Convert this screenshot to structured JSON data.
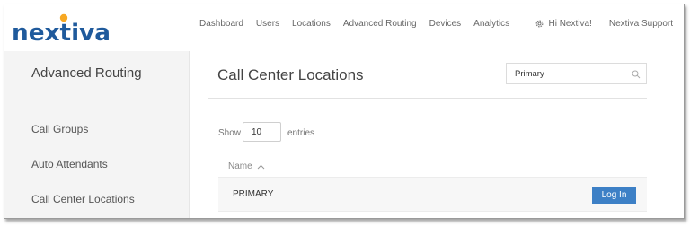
{
  "brand": {
    "logo_text": "nextiva",
    "logo_color": "#1f5a9c",
    "dot_color": "#f7a823"
  },
  "nav": {
    "items": [
      "Dashboard",
      "Users",
      "Locations",
      "Advanced Routing",
      "Devices",
      "Analytics"
    ],
    "greeting": "Hi Nextiva!",
    "support": "Nextiva Support",
    "gear_icon": "gear-icon"
  },
  "sidebar": {
    "title": "Advanced Routing",
    "items": [
      {
        "label": "Call Groups"
      },
      {
        "label": "Auto Attendants"
      },
      {
        "label": "Call Center Locations"
      }
    ]
  },
  "main": {
    "title": "Call Center Locations",
    "search": {
      "value": "Primary",
      "icon": "search-icon"
    },
    "show_label": "Show",
    "entries_value": "10",
    "entries_label": "entries",
    "table": {
      "columns": [
        {
          "label": "Name",
          "sort": "ascending"
        }
      ],
      "rows": [
        {
          "name": "PRIMARY",
          "action_label": "Log In"
        }
      ]
    }
  },
  "colors": {
    "accent": "#3d80c6",
    "sidebar_bg": "#f4f4f4"
  }
}
